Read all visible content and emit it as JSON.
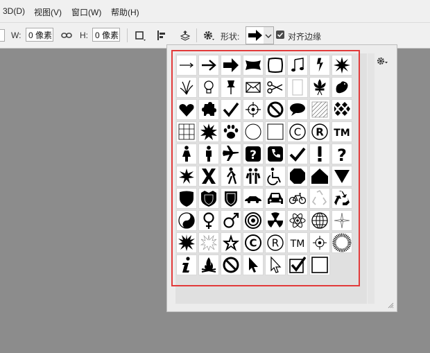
{
  "menu": [
    "3D(D)",
    "视图(V)",
    "窗口(W)",
    "帮助(H)"
  ],
  "options": {
    "w_label": "W:",
    "w_value": "0 像素",
    "h_label": "H:",
    "h_value": "0 像素",
    "shape_label": "形状:",
    "align_edges_label": "对齐边缘",
    "align_edges_checked": true
  },
  "shapes": [
    "arrow-thin-icon",
    "arrow-medium-icon",
    "arrow-bold-icon",
    "banner-icon",
    "frame-icon",
    "music-notes-icon",
    "lightning-icon",
    "starburst-icon",
    "grass-icon",
    "lightbulb-icon",
    "pushpin-icon",
    "envelope-icon",
    "scissors-icon",
    "blank-page-icon",
    "fleur-de-lis-icon",
    "bird-icon",
    "heart-icon",
    "puzzle-piece-icon",
    "checkmark-icon",
    "crosshair-icon",
    "no-symbol-icon",
    "speech-bubble-icon",
    "hatch-square-icon",
    "diamond-pattern-icon",
    "grid-icon",
    "burst-icon",
    "paw-print-icon",
    "circle-outline-icon",
    "square-outline-icon",
    "copyright-icon",
    "registered-icon",
    "trademark-icon",
    "woman-icon",
    "man-icon",
    "airplane-icon",
    "help-sign-icon",
    "phone-sign-icon",
    "checkmark-bold-icon",
    "exclamation-icon",
    "question-icon",
    "spark-burst-icon",
    "x-mark-icon",
    "hiker-icon",
    "couple-icon",
    "wheelchair-icon",
    "octagon-icon",
    "house-icon",
    "triangle-down-icon",
    "shield-icon",
    "shield-ornate-icon",
    "badge-icon",
    "car-side-icon",
    "car-front-icon",
    "bicycle-icon",
    "recycle-outline-icon",
    "recycle-icon",
    "yin-yang-icon",
    "female-icon",
    "male-icon",
    "target-icon",
    "radiation-icon",
    "atom-icon",
    "globe-icon",
    "compass-icon",
    "explosion-icon",
    "explosion-outline-icon",
    "star-icon",
    "copyright-bold-icon",
    "registered-bold-icon",
    "trademark-outline-icon",
    "crosshair-small-icon",
    "sunburst-icon",
    "info-icon",
    "campfire-icon",
    "prohibit-icon",
    "cursor-icon",
    "cursor-outline-icon",
    "checkbox-checked-icon",
    "checkbox-empty-icon"
  ]
}
